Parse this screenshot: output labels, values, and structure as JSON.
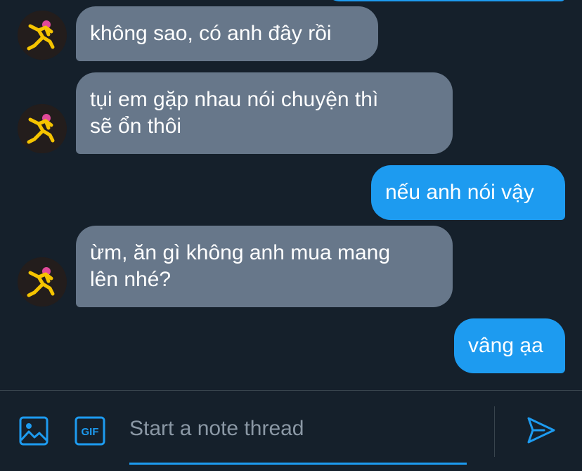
{
  "messages": [
    {
      "from": "them",
      "lines": [
        "không sao, có anh đây rồi"
      ]
    },
    {
      "from": "them",
      "lines": [
        "tụi em gặp nhau nói chuyện thì",
        "sẽ ổn thôi"
      ]
    },
    {
      "from": "me",
      "lines": [
        "nếu anh nói vậy"
      ]
    },
    {
      "from": "them",
      "lines": [
        "ừm, ăn gì không anh mua mang",
        "lên nhé?"
      ]
    },
    {
      "from": "me",
      "lines": [
        "vâng ạa"
      ]
    }
  ],
  "composer": {
    "placeholder": "Start a note thread",
    "media_icon": "image-icon",
    "gif_icon": "gif-icon",
    "gif_label": "GIF",
    "send_icon": "send-icon"
  },
  "colors": {
    "background": "#15202b",
    "incoming_bubble": "#67778a",
    "outgoing_bubble": "#1d9bf0",
    "accent": "#1d9bf0",
    "border": "#38444d"
  }
}
